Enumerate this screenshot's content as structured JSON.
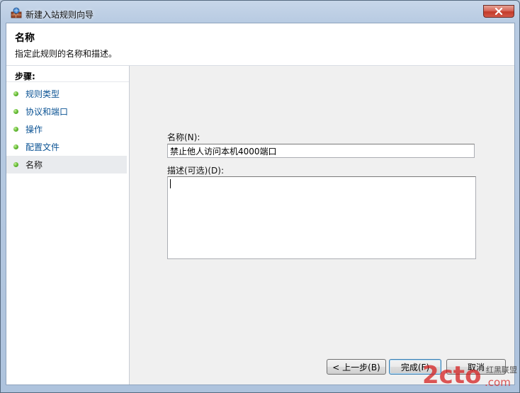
{
  "window": {
    "title": "新建入站规则向导",
    "close_glyph": "✕"
  },
  "header": {
    "title": "名称",
    "description": "指定此规则的名称和描述。"
  },
  "steps": {
    "heading": "步骤:",
    "items": [
      {
        "label": "规则类型",
        "active": false
      },
      {
        "label": "协议和端口",
        "active": false
      },
      {
        "label": "操作",
        "active": false
      },
      {
        "label": "配置文件",
        "active": false
      },
      {
        "label": "名称",
        "active": true
      }
    ]
  },
  "form": {
    "name_label": "名称(N):",
    "name_value": "禁止他人访问本机4000端口",
    "desc_label": "描述(可选)(D):",
    "desc_value": ""
  },
  "buttons": {
    "back": "< 上一步(B)",
    "finish": "完成(F)",
    "cancel": "取消"
  },
  "watermark": {
    "text": "2cto",
    "suffix": ".com",
    "small_text": "红黑联盟"
  },
  "colors": {
    "step_link": "#0b5394",
    "step_dot": "#6cc13a",
    "close_button": "#c33a28",
    "watermark_red": "#d42020"
  }
}
